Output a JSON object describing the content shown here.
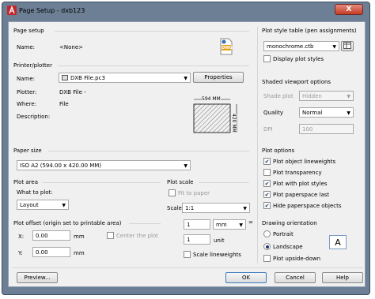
{
  "window": {
    "title": "Page Setup - dxb123",
    "close_glyph": "X"
  },
  "page_setup": {
    "section": "Page setup",
    "name_label": "Name:",
    "name_value": "<None>",
    "dwg_icon_text": "DWG"
  },
  "printer": {
    "section": "Printer/plotter",
    "name_label": "Name:",
    "device": "DXB File.pc3",
    "properties_button": "Properties",
    "plotter_label": "Plotter:",
    "plotter_value": "DXB File -",
    "where_label": "Where:",
    "where_value": "File",
    "description_label": "Description:",
    "width_dim": "594 MM",
    "height_dim": "420 MM"
  },
  "paper_size": {
    "section": "Paper size",
    "value": "ISO A2 (594.00 x 420.00 MM)"
  },
  "plot_area": {
    "section": "Plot area",
    "what_label": "What to plot:",
    "what_value": "Layout"
  },
  "plot_offset": {
    "section": "Plot offset (origin set to printable area)",
    "x_label": "X:",
    "x_value": "0.00",
    "y_label": "Y:",
    "y_value": "0.00",
    "unit": "mm",
    "center_label": "Center the plot"
  },
  "plot_scale": {
    "section": "Plot scale",
    "fit_label": "Fit to paper",
    "scale_label": "Scale:",
    "scale_value": "1:1",
    "num_value": "1",
    "num_unit": "mm",
    "den_value": "1",
    "den_unit": "unit",
    "lineweights_label": "Scale lineweights"
  },
  "style_table": {
    "section": "Plot style table (pen assignments)",
    "value": "monochrome.ctb",
    "display_label": "Display plot styles"
  },
  "shaded": {
    "section": "Shaded viewport options",
    "shade_label": "Shade plot",
    "shade_value": "Hidden",
    "quality_label": "Quality",
    "quality_value": "Normal",
    "dpi_label": "DPI",
    "dpi_value": "100"
  },
  "plot_options": {
    "section": "Plot options",
    "items": [
      "Plot object lineweights",
      "Plot transparency",
      "Plot with plot styles",
      "Plot paperspace last",
      "Hide paperspace objects"
    ],
    "checked": [
      true,
      false,
      true,
      true,
      true
    ]
  },
  "orientation": {
    "section": "Drawing orientation",
    "portrait": "Portrait",
    "landscape": "Landscape",
    "upside_down": "Plot upside-down",
    "icon_letter": "A"
  },
  "footer": {
    "preview": "Preview...",
    "ok": "OK",
    "cancel": "Cancel",
    "help": "Help"
  }
}
